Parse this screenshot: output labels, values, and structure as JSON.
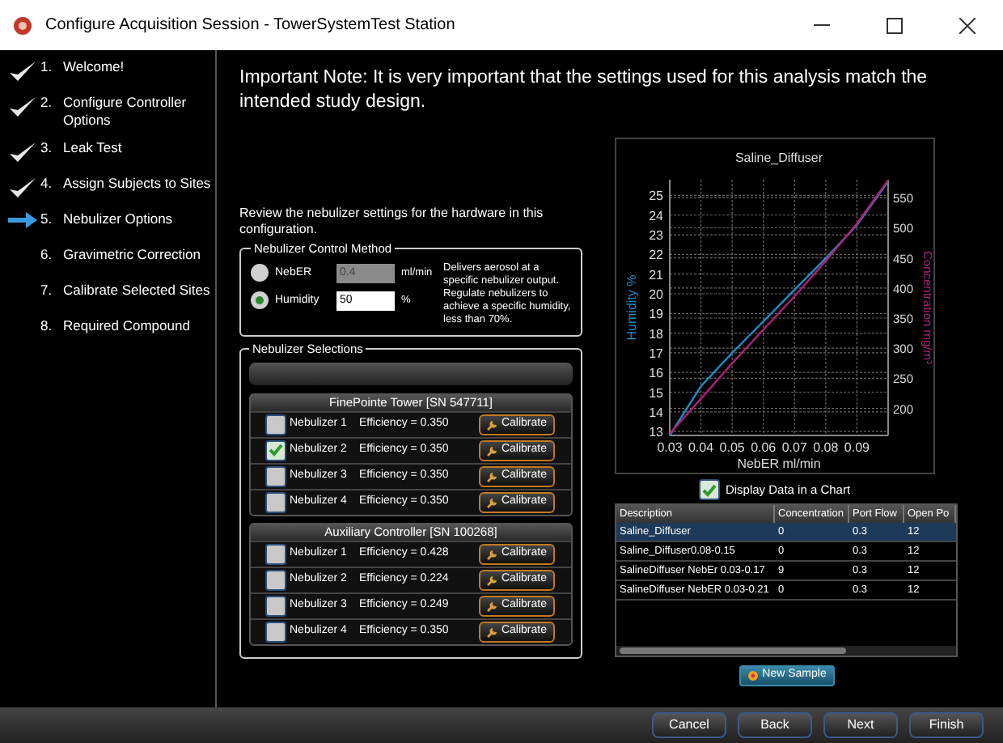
{
  "window": {
    "title": "Configure Acquisition Session - TowerSystemTest Station"
  },
  "steps": [
    {
      "number": "1.",
      "label": "Welcome!",
      "completed": true,
      "selected": false
    },
    {
      "number": "2.",
      "label": "Configure Controller Options",
      "completed": true,
      "selected": false
    },
    {
      "number": "3.",
      "label": "Leak Test",
      "completed": true,
      "selected": false
    },
    {
      "number": "4.",
      "label": "Assign Subjects to Sites",
      "completed": true,
      "selected": false
    },
    {
      "number": "5.",
      "label": "Nebulizer Options",
      "completed": false,
      "selected": true
    },
    {
      "number": "6.",
      "label": "Gravimetric Correction",
      "completed": false,
      "selected": false
    },
    {
      "number": "7.",
      "label": "Calibrate Selected Sites",
      "completed": false,
      "selected": false
    },
    {
      "number": "8.",
      "label": "Required Compound",
      "completed": false,
      "selected": false
    }
  ],
  "note": "Important Note: It is very important that the settings used for this analysis match the intended study design.",
  "review_text": "Review the nebulizer settings for the hardware in this configuration.",
  "control_method": {
    "title": "Nebulizer Control Method",
    "options": [
      {
        "label": "NebER",
        "value": "0.4",
        "unit": "ml/min",
        "description": "Delivers aerosol at a specific nebulizer output.",
        "selected": false,
        "disabled": true
      },
      {
        "label": "Humidity",
        "value": "50",
        "unit": "%",
        "description": "Regulate nebulizers to achieve a specific humidity, less than 70%.",
        "selected": true,
        "disabled": false
      }
    ]
  },
  "nebulizer_selections": {
    "title": "Nebulizer Selections",
    "groups": [
      {
        "title": "FinePointe Tower [SN 547711]",
        "nebulizers": [
          {
            "name": "Nebulizer 1",
            "efficiency": "Efficiency = 0.350",
            "checked": false,
            "button": "Calibrate"
          },
          {
            "name": "Nebulizer 2",
            "efficiency": "Efficiency = 0.350",
            "checked": true,
            "button": "Calibrate"
          },
          {
            "name": "Nebulizer 3",
            "efficiency": "Efficiency = 0.350",
            "checked": false,
            "button": "Calibrate"
          },
          {
            "name": "Nebulizer 4",
            "efficiency": "Efficiency = 0.350",
            "checked": false,
            "button": "Calibrate"
          }
        ]
      },
      {
        "title": "Auxiliary Controller [SN 100268]",
        "nebulizers": [
          {
            "name": "Nebulizer 1",
            "efficiency": "Efficiency = 0.428",
            "checked": false,
            "button": "Calibrate"
          },
          {
            "name": "Nebulizer 2",
            "efficiency": "Efficiency = 0.224",
            "checked": false,
            "button": "Calibrate"
          },
          {
            "name": "Nebulizer 3",
            "efficiency": "Efficiency = 0.249",
            "checked": false,
            "button": "Calibrate"
          },
          {
            "name": "Nebulizer 4",
            "efficiency": "Efficiency = 0.350",
            "checked": false,
            "button": "Calibrate"
          }
        ]
      }
    ]
  },
  "chart": {
    "chart_data": {
      "type": "line",
      "grid": true,
      "title": "Saline_Diffuser",
      "xlabel": "NebER ml/min",
      "ylabel": "Humidity %",
      "y2label": "Concentration mg/m³",
      "x": [
        0.03,
        0.04,
        0.05,
        0.06,
        0.07,
        0.08,
        0.09,
        0.1
      ],
      "series": [
        {
          "color": "#1e90c8",
          "values": [
            12.8,
            15.3,
            17,
            18.6,
            20.2,
            21.8,
            23.5,
            25.7
          ]
        },
        {
          "color": "#b0207a",
          "axis": "y2",
          "values": [
            158,
            216,
            275,
            331,
            386,
            445,
            507,
            579
          ]
        }
      ],
      "xlim": [
        0.03,
        0.1
      ],
      "ylim": [
        12.8,
        25.8
      ],
      "y2lim": [
        155,
        580
      ],
      "xticks": [
        0.03,
        0.04,
        0.05,
        0.06,
        0.07,
        0.08,
        0.09
      ],
      "yticks": [
        13,
        14,
        15,
        16,
        17,
        18,
        19,
        20,
        21,
        22,
        23,
        24,
        25
      ],
      "y2ticks": [
        200,
        250,
        300,
        350,
        400,
        450,
        500,
        550
      ]
    }
  },
  "display_chart": {
    "label": "Display Data in a Chart",
    "checked": true
  },
  "table": {
    "columns": [
      "Description",
      "Concentration",
      "Port Flow",
      "Open Po"
    ],
    "rows": [
      {
        "cells": [
          "Saline_Diffuser",
          "0",
          "0.3",
          "12"
        ],
        "selected": true
      },
      {
        "cells": [
          "Saline_Diffuser0.08-0.15",
          "0",
          "0.3",
          "12"
        ],
        "selected": false
      },
      {
        "cells": [
          "SalineDiffuser NebEr 0.03-0.17",
          "9",
          "0.3",
          "12"
        ],
        "selected": false
      },
      {
        "cells": [
          "SalineDiffuser NebER 0.03-0.21",
          "0",
          "0.3",
          "12"
        ],
        "selected": false
      }
    ]
  },
  "new_sample": "New Sample",
  "buttons": [
    "Cancel",
    "Back",
    "Next",
    "Finish"
  ]
}
